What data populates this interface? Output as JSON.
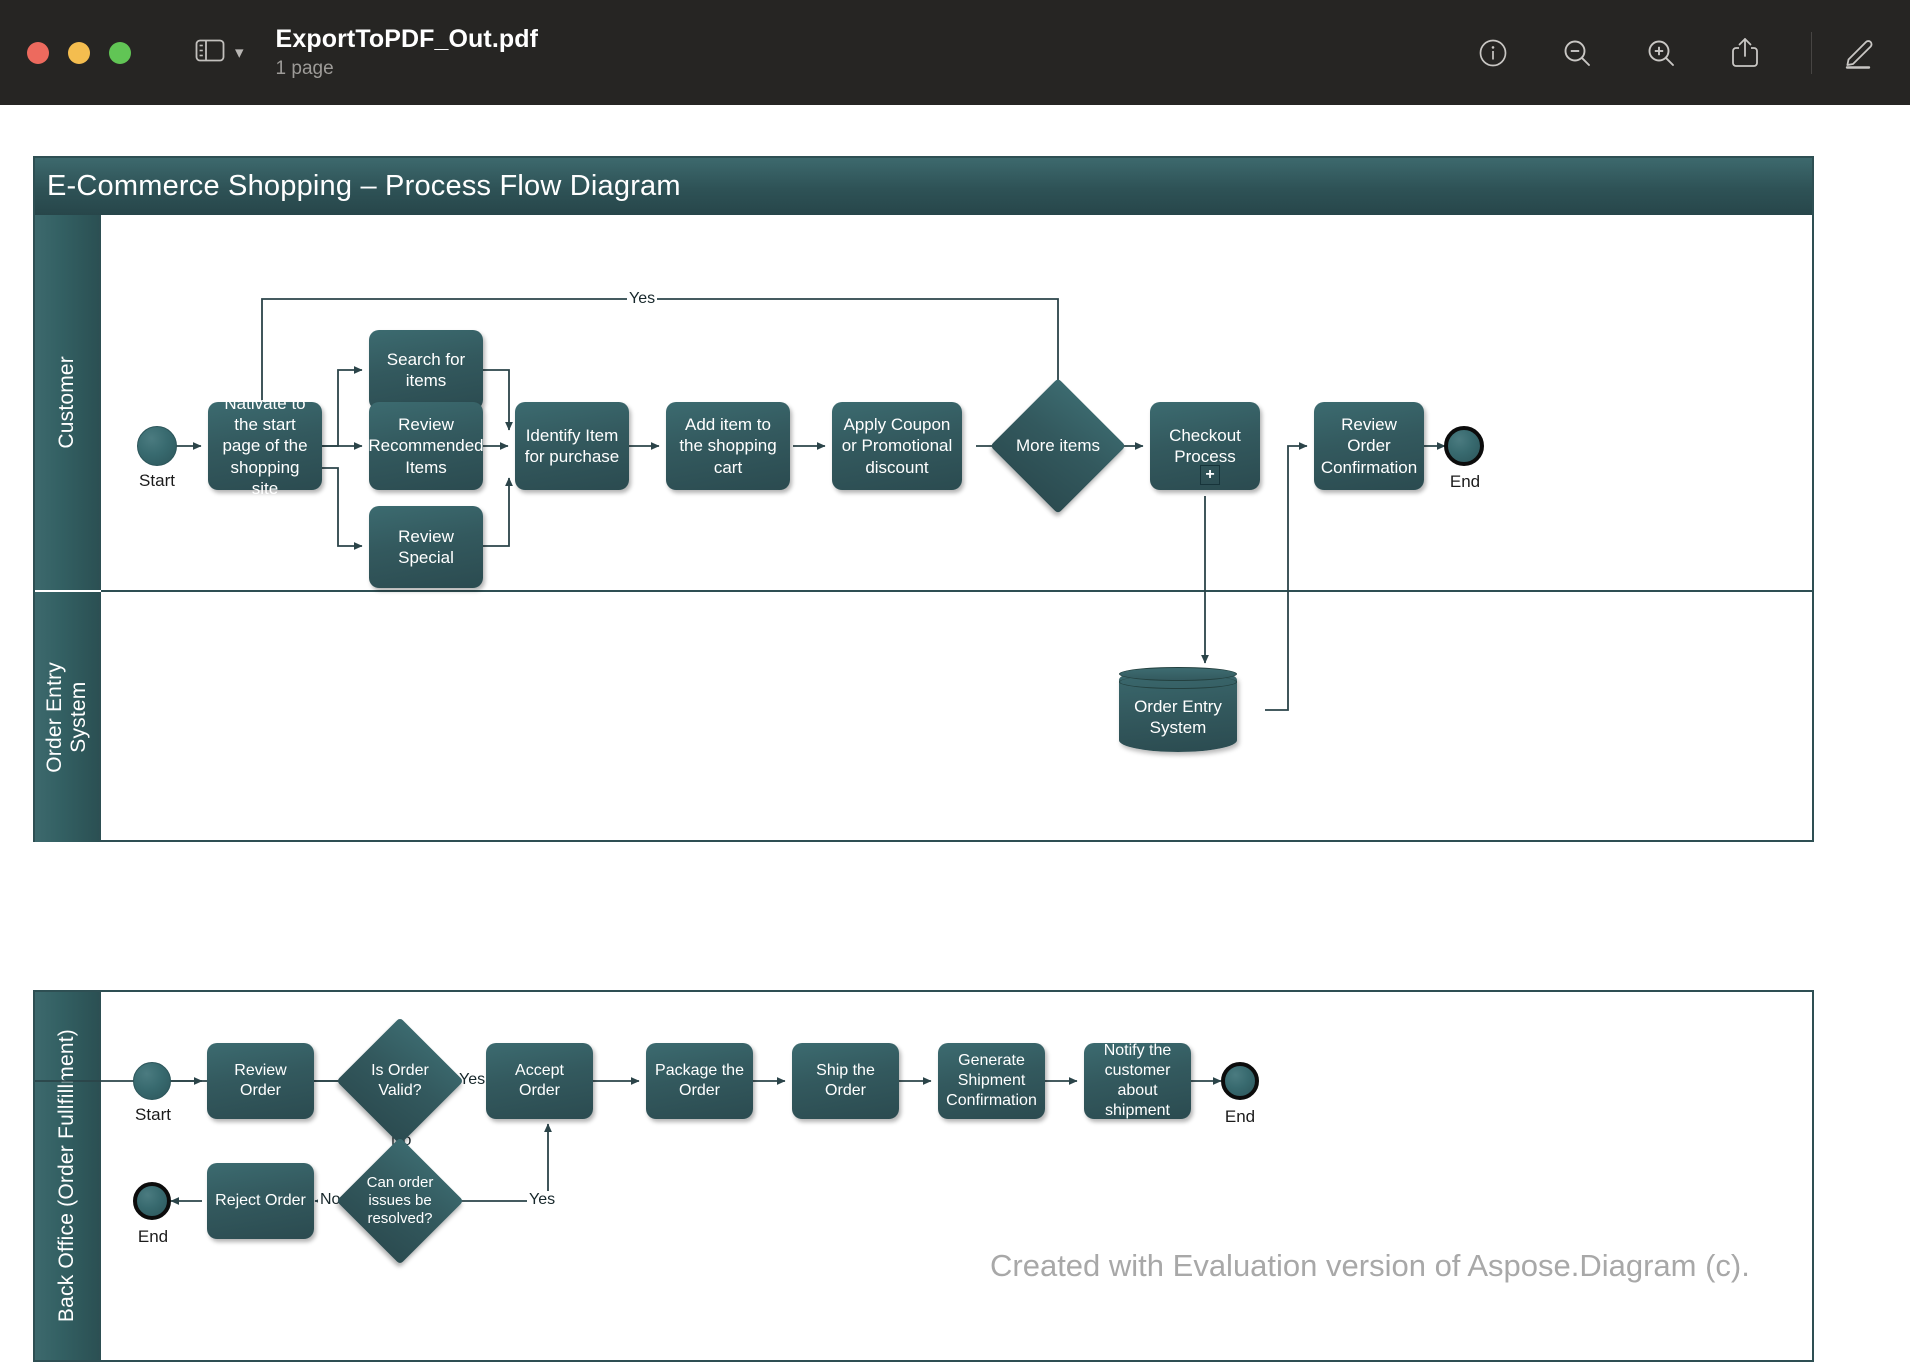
{
  "window": {
    "title": "ExportToPDF_Out.pdf",
    "subtitle": "1 page",
    "traffic_lights": [
      "close",
      "minimize",
      "zoom"
    ],
    "toolbar_icons": [
      "sidebar-icon",
      "chevron-down-icon",
      "info-icon",
      "zoom-out-icon",
      "zoom-in-icon",
      "share-icon",
      "markup-pen-icon"
    ]
  },
  "colors": {
    "titlebar_bg": "#262523",
    "pool_header": "#2e5256",
    "node_fill": "#33595e",
    "node_text": "#ffffff",
    "border": "#2e4f53",
    "watermark": "#a8a8a8"
  },
  "diagram": {
    "title": "E-Commerce Shopping – Process Flow Diagram",
    "watermark": "Created with Evaluation version of Aspose.Diagram (c).",
    "pool1": {
      "lanes": [
        {
          "label": "Customer"
        },
        {
          "label": "Order Entry\nSystem"
        }
      ],
      "customer_lane": {
        "start_event": {
          "label": "Start"
        },
        "end_event": {
          "label": "End"
        },
        "tasks": [
          {
            "id": "navigate",
            "label": "Nativate to the start page of the shopping site"
          },
          {
            "id": "search",
            "label": "Search for items"
          },
          {
            "id": "review_rec",
            "label": "Review Recommended Items"
          },
          {
            "id": "review_special",
            "label": "Review Special"
          },
          {
            "id": "identify",
            "label": "Identify Item for purchase"
          },
          {
            "id": "add_cart",
            "label": "Add item to the shopping cart"
          },
          {
            "id": "coupon",
            "label": "Apply Coupon or Promotional discount"
          },
          {
            "id": "checkout",
            "label": "Checkout Process",
            "marker": "+"
          },
          {
            "id": "review_conf",
            "label": "Review Order Confirmation"
          }
        ],
        "gateways": [
          {
            "id": "more_items",
            "label": "More items"
          }
        ],
        "flow_labels": [
          {
            "id": "yes_more_items",
            "label": "Yes"
          }
        ]
      },
      "order_entry_lane": {
        "data_store": {
          "label": "Order Entry System"
        }
      }
    },
    "pool2": {
      "lanes": [
        {
          "label": "Back Office (Order Fullfillment)"
        }
      ],
      "start_event": {
        "label": "Start"
      },
      "end_events": [
        {
          "id": "end_success",
          "label": "End"
        },
        {
          "id": "end_reject",
          "label": "End"
        }
      ],
      "tasks": [
        {
          "id": "review_order",
          "label": "Review Order"
        },
        {
          "id": "accept_order",
          "label": "Accept Order"
        },
        {
          "id": "package_order",
          "label": "Package the Order"
        },
        {
          "id": "ship_order",
          "label": "Ship the Order"
        },
        {
          "id": "gen_shipment",
          "label": "Generate Shipment Confirmation"
        },
        {
          "id": "notify",
          "label": "Notify the customer about shipment"
        },
        {
          "id": "reject_order",
          "label": "Reject Order"
        }
      ],
      "gateways": [
        {
          "id": "is_valid",
          "label": "Is Order Valid?"
        },
        {
          "id": "can_resolve",
          "label": "Can order issues be resolved?"
        }
      ],
      "flow_labels": [
        {
          "id": "valid_yes",
          "label": "Yes"
        },
        {
          "id": "valid_no",
          "label": "No"
        },
        {
          "id": "resolve_no",
          "label": "No"
        },
        {
          "id": "resolve_yes",
          "label": "Yes"
        }
      ]
    }
  }
}
